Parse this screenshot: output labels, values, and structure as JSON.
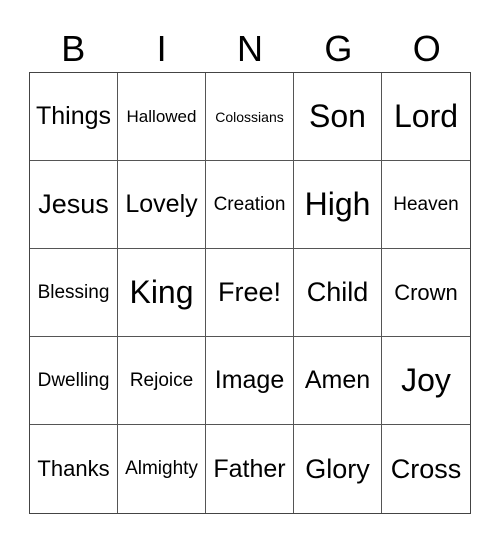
{
  "header": [
    "B",
    "I",
    "N",
    "G",
    "O"
  ],
  "cells": [
    [
      "Things",
      "Hallowed",
      "Colossians",
      "Son",
      "Lord"
    ],
    [
      "Jesus",
      "Lovely",
      "Creation",
      "High",
      "Heaven"
    ],
    [
      "Blessing",
      "King",
      "Free!",
      "Child",
      "Crown"
    ],
    [
      "Dwelling",
      "Rejoice",
      "Image",
      "Amen",
      "Joy"
    ],
    [
      "Thanks",
      "Almighty",
      "Father",
      "Glory",
      "Cross"
    ]
  ]
}
